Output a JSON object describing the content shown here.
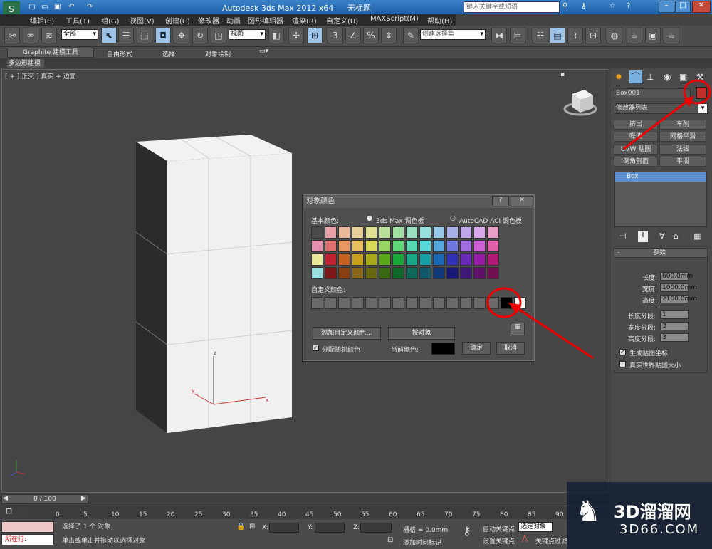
{
  "title": {
    "app": "Autodesk 3ds Max  2012 x64",
    "doc": "无标题",
    "search_placeholder": "键入关键字或短语"
  },
  "menu": [
    "编辑(E)",
    "工具(T)",
    "组(G)",
    "视图(V)",
    "创建(C)",
    "修改器",
    "动画",
    "图形编辑器",
    "渲染(R)",
    "自定义(U)",
    "MAXScript(M)",
    "帮助(H)"
  ],
  "toolbar": {
    "filter": "全部",
    "refcoord": "视图",
    "selset": "创建选择集"
  },
  "ribbon": {
    "tabs": [
      "Graphite 建模工具",
      "自由形式",
      "选择",
      "对象绘制"
    ],
    "sub": "多边形建模"
  },
  "viewport": {
    "label": "[ + ] 正交 ] 真实 + 边面"
  },
  "panel": {
    "name": "Box001",
    "modlist": "修改器列表",
    "mods": [
      "挤出",
      "车削",
      "噪波",
      "网格平滑",
      "UVW 贴图",
      "法线",
      "倒角剖面",
      "平滑"
    ],
    "stack": "Box",
    "params_title": "参数",
    "params": [
      {
        "label": "长度:",
        "value": "600.0mm"
      },
      {
        "label": "宽度:",
        "value": "1000.0mm"
      },
      {
        "label": "高度:",
        "value": "2100.0mm"
      },
      {
        "label": "长度分段:",
        "value": "1"
      },
      {
        "label": "宽度分段:",
        "value": "3"
      },
      {
        "label": "高度分段:",
        "value": "3"
      }
    ],
    "gen_map": "生成贴图坐标",
    "real_world": "真实世界贴图大小"
  },
  "dialog": {
    "title": "对象颜色",
    "basic": "基本颜色:",
    "opt1": "3ds Max 调色板",
    "opt2": "AutoCAD ACI 调色板",
    "custom": "自定义颜色:",
    "add_custom": "添加自定义颜色...",
    "by_object": "按对象",
    "assign_random": "分配随机颜色",
    "current": "当前颜色:",
    "ok": "确定",
    "cancel": "取消",
    "colors": [
      "#4a4a4a",
      "#e8a0a8",
      "#e8b898",
      "#e8d098",
      "#e0e090",
      "#b8e098",
      "#a0e0a0",
      "#98e0c0",
      "#98e0e0",
      "#98c8e8",
      "#a8b0e8",
      "#c0a8e8",
      "#d8a8e8",
      "#e8a0c8",
      "#e890b0",
      "#e07070",
      "#e89860",
      "#e8c060",
      "#d8d858",
      "#98d860",
      "#60d878",
      "#58d8b0",
      "#58d8d8",
      "#58a8e0",
      "#7078e0",
      "#a070e0",
      "#d060d8",
      "#e060a8",
      "#e8e898",
      "#c02030",
      "#c86020",
      "#c8a020",
      "#a8a818",
      "#58a818",
      "#18a838",
      "#18a888",
      "#18a0a8",
      "#1868b8",
      "#3030b8",
      "#6828b8",
      "#9818a8",
      "#b01878",
      "#98e0e0",
      "#801818",
      "#884010",
      "#886818",
      "#686810",
      "#386810",
      "#106828",
      "#106858",
      "#105868",
      "#103878",
      "#181878",
      "#401878",
      "#601068",
      "#701050"
    ],
    "current_color": "#000000"
  },
  "timeline": {
    "frame": "0 / 100",
    "ticks": [
      "0",
      "5",
      "10",
      "15",
      "20",
      "25",
      "30",
      "35",
      "40",
      "45",
      "50",
      "55",
      "60",
      "65",
      "70",
      "75",
      "80",
      "85",
      "90",
      "95"
    ]
  },
  "status": {
    "now": "所在行:",
    "selected": "选择了 1 个 对象",
    "prompt": "单击或单击并拖动以选择对象",
    "grid": "栅格 = 0.0mm",
    "addtime": "添加时间标记",
    "autokey": "自动关键点",
    "selobj": "选定对象",
    "setkey": "设置关键点",
    "keyfilter": "关键点过滤",
    "x": "X:",
    "y": "Y:",
    "z": "Z:"
  },
  "watermark": {
    "brand": "3D溜溜网",
    "url": "3D66.COM"
  }
}
